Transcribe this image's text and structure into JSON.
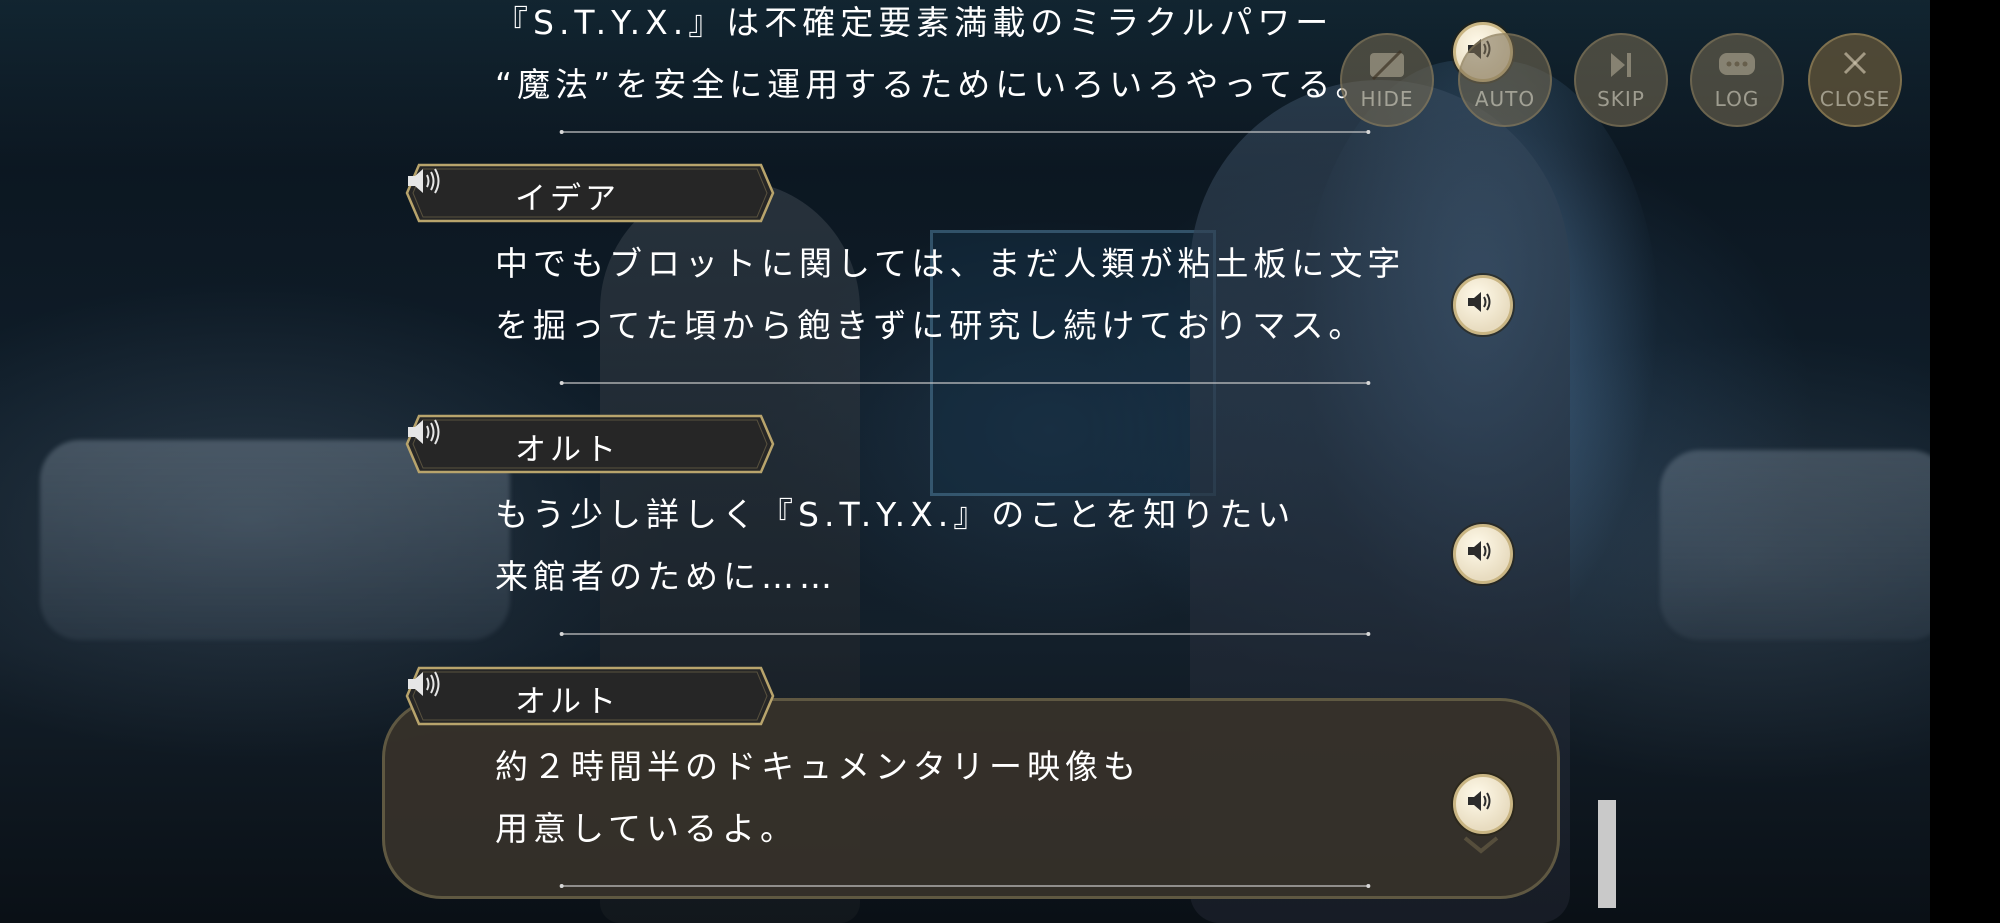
{
  "controls": {
    "hide": "HIDE",
    "auto": "AUTO",
    "skip": "SKIP",
    "log": "LOG",
    "close": "CLOSE"
  },
  "log_entries": [
    {
      "speaker": "",
      "lines": [
        "『S.T.Y.X.』は不確定要素満載のミラクルパワー",
        "“魔法”を安全に運用するためにいろいろやってる。"
      ]
    },
    {
      "speaker": "イデア",
      "lines": [
        "中でもブロットに関しては、まだ人類が粘土板に文字",
        "を掘ってた頃から飽きずに研究し続けておりマス。"
      ]
    },
    {
      "speaker": "オルト",
      "lines": [
        "もう少し詳しく『S.T.Y.X.』のことを知りたい",
        "来館者のために……"
      ]
    },
    {
      "speaker": "オルト",
      "lines": [
        "約２時間半のドキュメンタリー映像も",
        "用意しているよ。"
      ]
    }
  ],
  "icons": {
    "voice": "speaker-icon",
    "hide": "hide-icon",
    "skip": "skip-icon",
    "log": "log-icon",
    "close": "close-icon",
    "next": "chevron-down-icon"
  },
  "colors": {
    "nameplate_fill": "#262626",
    "nameplate_border": "#b8a46c",
    "dialog_bg": "#37322a",
    "gold": "#c9b583",
    "text": "#ffffff"
  }
}
